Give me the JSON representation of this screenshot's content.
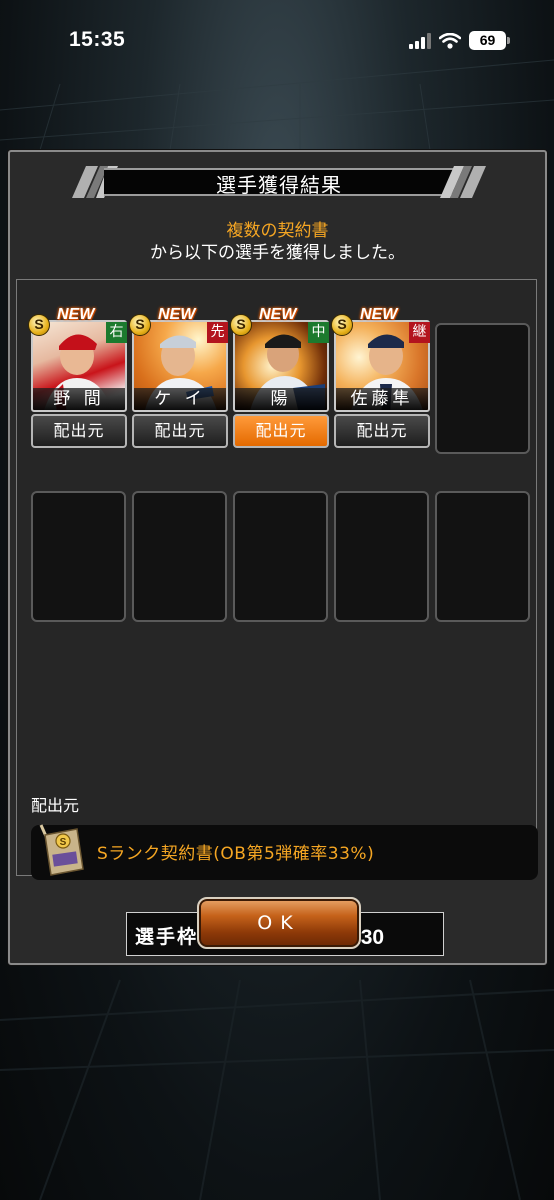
{
  "status_bar": {
    "time": "15:35",
    "battery": "69"
  },
  "dialog": {
    "title": "選手獲得結果",
    "message_highlight": "複数の契約書",
    "message": "から以下の選手を獲得しました。"
  },
  "cards": [
    {
      "name": "野 間",
      "position": "右",
      "position_color": "#1c7a2e",
      "badge": "NEW",
      "rank": "S",
      "origin_label": "配出元",
      "active": false
    },
    {
      "name": "ケ イ",
      "position": "先",
      "position_color": "#b3141e",
      "badge": "NEW",
      "rank": "S",
      "origin_label": "配出元",
      "active": false
    },
    {
      "name": "陽",
      "position": "中",
      "position_color": "#1c7a2e",
      "badge": "NEW",
      "rank": "S",
      "origin_label": "配出元",
      "active": true
    },
    {
      "name": "佐藤隼",
      "position": "継",
      "position_color": "#b3141e",
      "badge": "NEW",
      "rank": "S",
      "origin_label": "配出元",
      "active": false
    }
  ],
  "source": {
    "label": "配出元",
    "item": "Sランク契約書(OB第5弾確率33%)"
  },
  "capacity": {
    "label": "選手枠：",
    "value": "212／230"
  },
  "ok_button": "OK",
  "colors": {
    "accent": "#f5a623",
    "orange_button": "#e46a00"
  }
}
